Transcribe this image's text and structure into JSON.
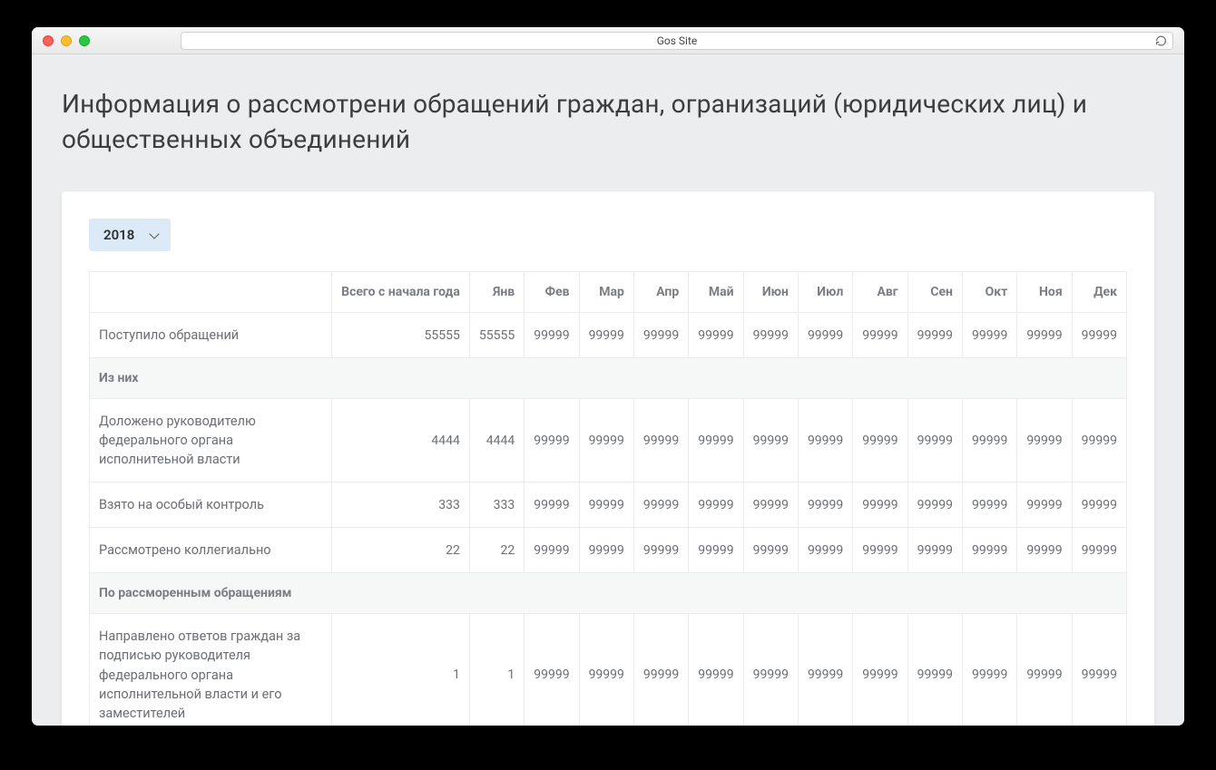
{
  "window": {
    "title": "Gos Site"
  },
  "page_title": "Информация о рассмотрени обращений граждан, огранизаций (юридических лиц) и общественных объединений",
  "year": "2018",
  "headers": [
    "",
    "Всего с начала года",
    "Янв",
    "Фев",
    "Мар",
    "Апр",
    "Май",
    "Июн",
    "Июл",
    "Авг",
    "Сен",
    "Окт",
    "Ноя",
    "Дек"
  ],
  "rows": [
    {
      "type": "data",
      "label": "Поступило обращений",
      "values": [
        "55555",
        "55555",
        "99999",
        "99999",
        "99999",
        "99999",
        "99999",
        "99999",
        "99999",
        "99999",
        "99999",
        "99999",
        "99999"
      ]
    },
    {
      "type": "section",
      "label": "Из них"
    },
    {
      "type": "data",
      "label": "Доложено руководителю федерального органа исполнитеьной власти",
      "values": [
        "4444",
        "4444",
        "99999",
        "99999",
        "99999",
        "99999",
        "99999",
        "99999",
        "99999",
        "99999",
        "99999",
        "99999",
        "99999"
      ]
    },
    {
      "type": "data",
      "label": "Взято на особый контроль",
      "values": [
        "333",
        "333",
        "99999",
        "99999",
        "99999",
        "99999",
        "99999",
        "99999",
        "99999",
        "99999",
        "99999",
        "99999",
        "99999"
      ]
    },
    {
      "type": "data",
      "label": "Рассмотрено коллегиально",
      "values": [
        "22",
        "22",
        "99999",
        "99999",
        "99999",
        "99999",
        "99999",
        "99999",
        "99999",
        "99999",
        "99999",
        "99999",
        "99999"
      ]
    },
    {
      "type": "section",
      "label": "По рассморенным обращениям"
    },
    {
      "type": "data",
      "label": "Направлено ответов граждан за подписью руководителя федерального органа исполнительной власти и его заместителей",
      "values": [
        "1",
        "1",
        "99999",
        "99999",
        "99999",
        "99999",
        "99999",
        "99999",
        "99999",
        "99999",
        "99999",
        "99999",
        "99999"
      ]
    }
  ]
}
